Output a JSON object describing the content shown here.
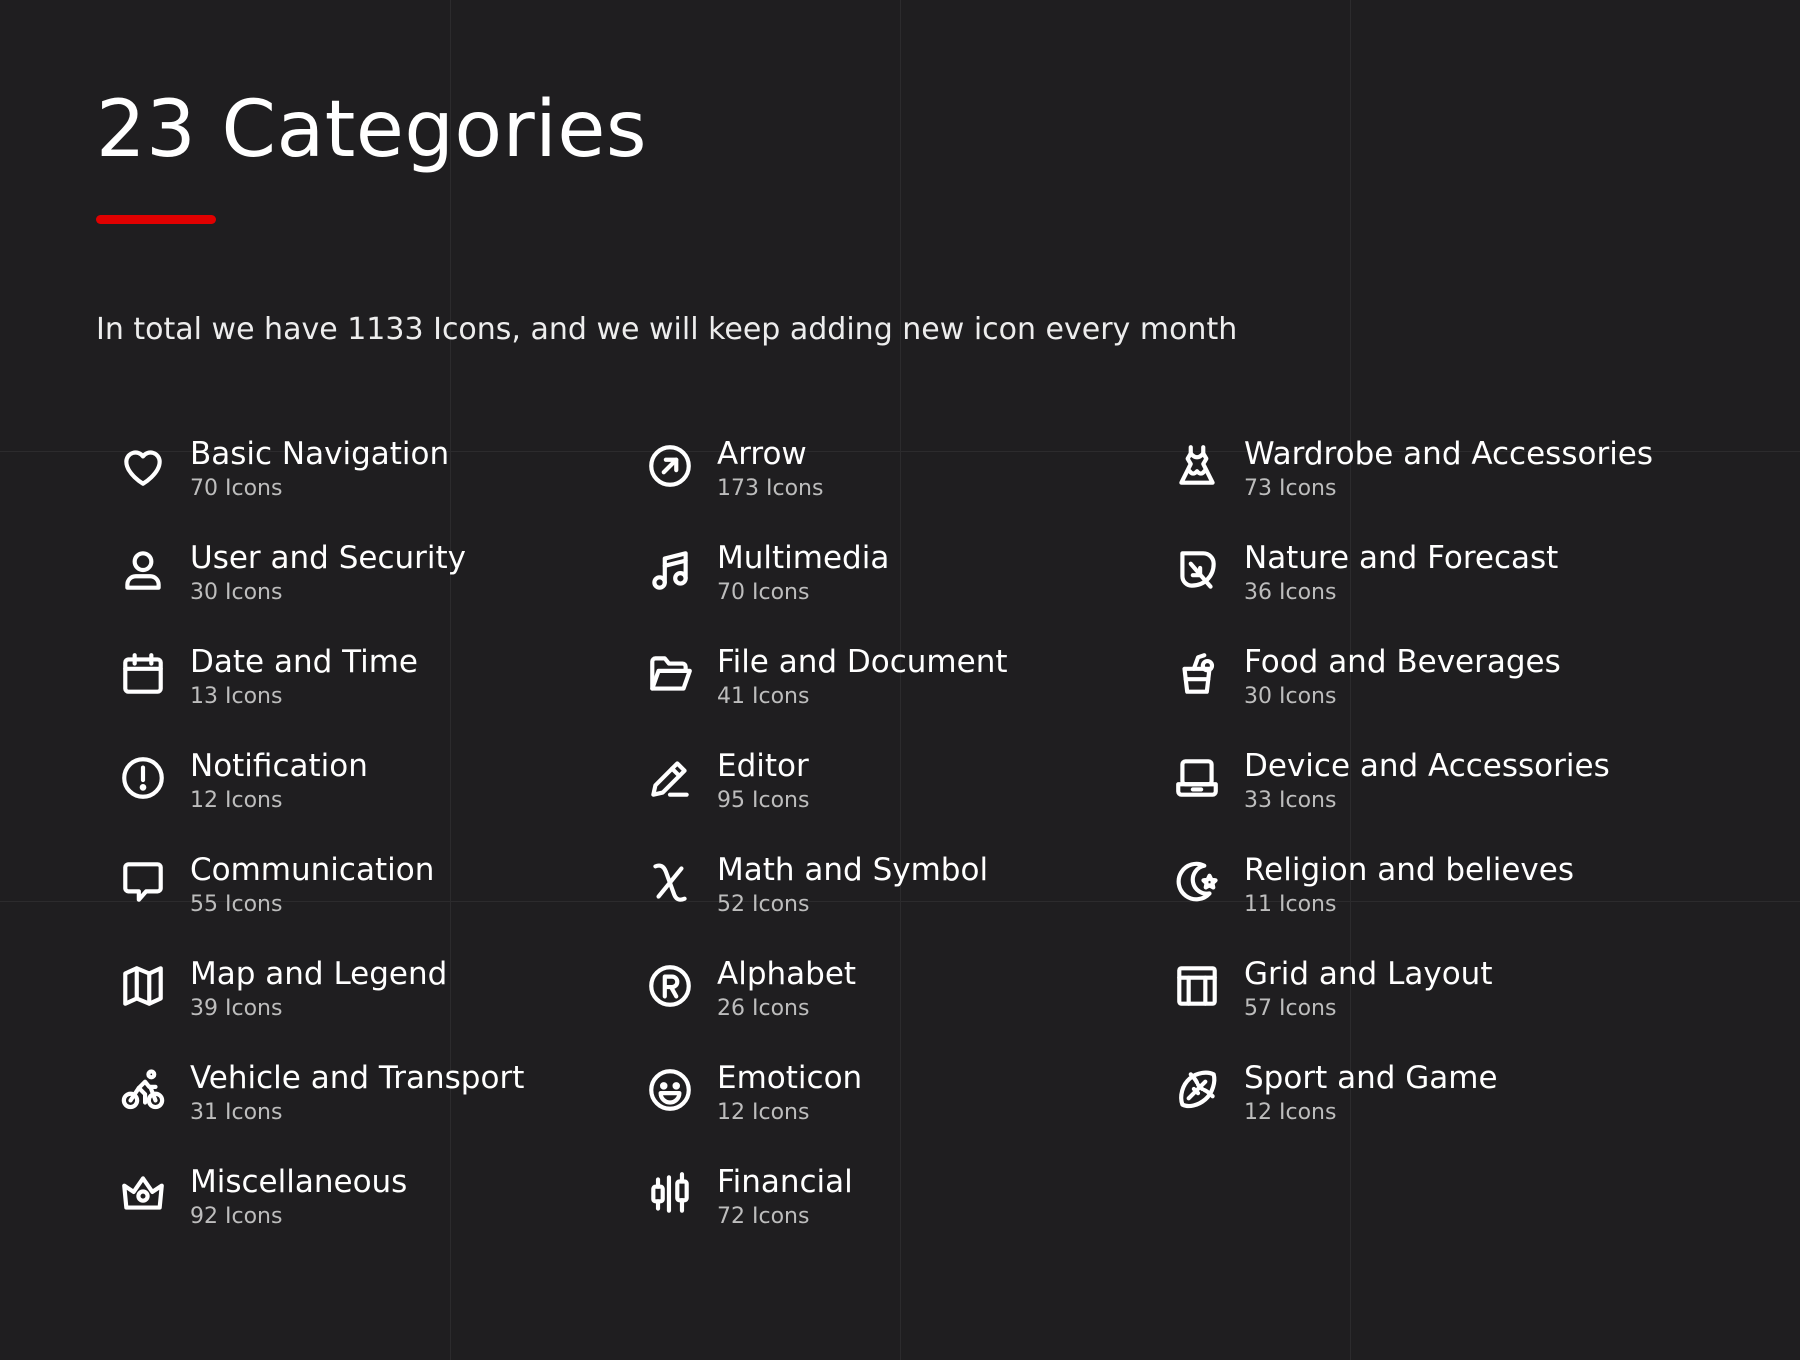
{
  "page": {
    "title": "23 Categories",
    "subtitle": "In total we have 1133 Icons, and we will keep adding new icon every month",
    "accent_color": "#e00000",
    "background_color": "#1f1e20"
  },
  "categories": [
    {
      "name": "Basic Navigation",
      "count": "70 Icons",
      "icon": "heart-icon"
    },
    {
      "name": "Arrow",
      "count": "173 Icons",
      "icon": "arrow-up-right-circle-icon"
    },
    {
      "name": "Wardrobe and Accessories",
      "count": "73 Icons",
      "icon": "dress-icon"
    },
    {
      "name": "User and Security",
      "count": "30 Icons",
      "icon": "user-icon"
    },
    {
      "name": "Multimedia",
      "count": "70 Icons",
      "icon": "music-note-icon"
    },
    {
      "name": "Nature and Forecast",
      "count": "36 Icons",
      "icon": "leaf-icon"
    },
    {
      "name": "Date and Time",
      "count": "13 Icons",
      "icon": "calendar-icon"
    },
    {
      "name": "File and Document",
      "count": "41 Icons",
      "icon": "folder-icon"
    },
    {
      "name": "Food and Beverages",
      "count": "30 Icons",
      "icon": "drink-cup-icon"
    },
    {
      "name": "Notification",
      "count": "12 Icons",
      "icon": "exclamation-circle-icon"
    },
    {
      "name": "Editor",
      "count": "95 Icons",
      "icon": "pencil-icon"
    },
    {
      "name": "Device and Accessories",
      "count": "33 Icons",
      "icon": "laptop-icon"
    },
    {
      "name": "Communication",
      "count": "55 Icons",
      "icon": "chat-bubble-icon"
    },
    {
      "name": "Math and Symbol",
      "count": "52 Icons",
      "icon": "chi-symbol-icon"
    },
    {
      "name": "Religion and believes",
      "count": "11 Icons",
      "icon": "crescent-star-icon"
    },
    {
      "name": "Map and Legend",
      "count": "39 Icons",
      "icon": "map-icon"
    },
    {
      "name": "Alphabet",
      "count": "26 Icons",
      "icon": "registered-icon"
    },
    {
      "name": "Grid and Layout",
      "count": "57 Icons",
      "icon": "layout-icon"
    },
    {
      "name": "Vehicle and Transport",
      "count": "31 Icons",
      "icon": "cyclist-icon"
    },
    {
      "name": "Emoticon",
      "count": "12 Icons",
      "icon": "smiley-icon"
    },
    {
      "name": "Sport and Game",
      "count": "12 Icons",
      "icon": "football-icon"
    },
    {
      "name": "Miscellaneous",
      "count": "92 Icons",
      "icon": "crown-icon"
    },
    {
      "name": "Financial",
      "count": "72 Icons",
      "icon": "candlestick-icon"
    }
  ]
}
